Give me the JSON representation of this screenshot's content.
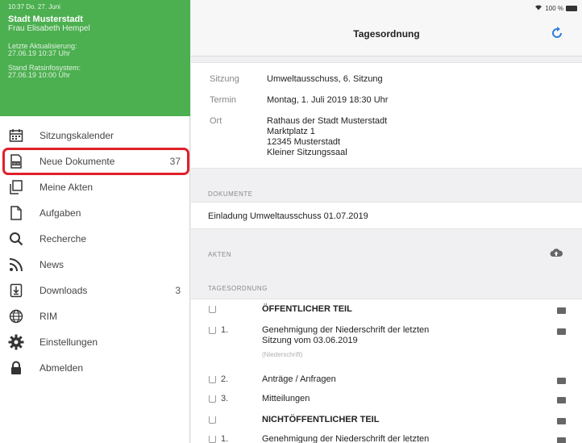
{
  "sidebar": {
    "status": "10:37  Do. 27. Juni",
    "org": "Stadt Musterstadt",
    "user": "Frau Elisabeth Hempel",
    "last_update_label": "Letzte Aktualisierung:",
    "last_update_value": "27.06.19 10:37 Uhr",
    "system_label": "Stand Ratsinfosystem:",
    "system_value": "27.06.19 10:00 Uhr",
    "items": [
      {
        "label": "Sitzungskalender",
        "count": ""
      },
      {
        "label": "Neue Dokumente",
        "count": "37"
      },
      {
        "label": "Meine Akten",
        "count": ""
      },
      {
        "label": "Aufgaben",
        "count": ""
      },
      {
        "label": "Recherche",
        "count": ""
      },
      {
        "label": "News",
        "count": ""
      },
      {
        "label": "Downloads",
        "count": "3"
      },
      {
        "label": "RIM",
        "count": ""
      },
      {
        "label": "Einstellungen",
        "count": ""
      },
      {
        "label": "Abmelden",
        "count": ""
      }
    ]
  },
  "header": {
    "battery": "100 %",
    "title": "Tagesordnung"
  },
  "meeting": {
    "sitzung_label": "Sitzung",
    "sitzung_value": "Umweltausschuss, 6. Sitzung",
    "termin_label": "Termin",
    "termin_value": "Montag, 1. Juli 2019 18:30 Uhr",
    "ort_label": "Ort",
    "ort_lines": [
      "Rathaus der Stadt Musterstadt",
      "Marktplatz 1",
      "12345 Musterstadt",
      "Kleiner Sitzungssaal"
    ]
  },
  "documents": {
    "section_label": "DOKUMENTE",
    "item": "Einladung Umweltausschuss 01.07.2019"
  },
  "akten": {
    "section_label": "AKTEN"
  },
  "agenda": {
    "section_label": "TAGESORDNUNG",
    "rows": [
      {
        "num": "",
        "text": "ÖFFENTLICHER TEIL",
        "bold": true
      },
      {
        "num": "1.",
        "text": "Genehmigung der Niederschrift der letzten",
        "text2": "Sitzung vom 03.06.2019",
        "sub": "(Niederschrift)"
      },
      {
        "num": "2.",
        "text": "Anträge / Anfragen"
      },
      {
        "num": "3.",
        "text": "Mitteilungen"
      },
      {
        "num": "",
        "text": "NICHTÖFFENTLICHER TEIL",
        "bold": true
      },
      {
        "num": "1.",
        "text": "Genehmigung der Niederschrift der letzten"
      }
    ]
  },
  "colors": {
    "brand_green": "#4caf50",
    "highlight_red": "#e0202a",
    "accent_blue": "#2f7de1"
  }
}
